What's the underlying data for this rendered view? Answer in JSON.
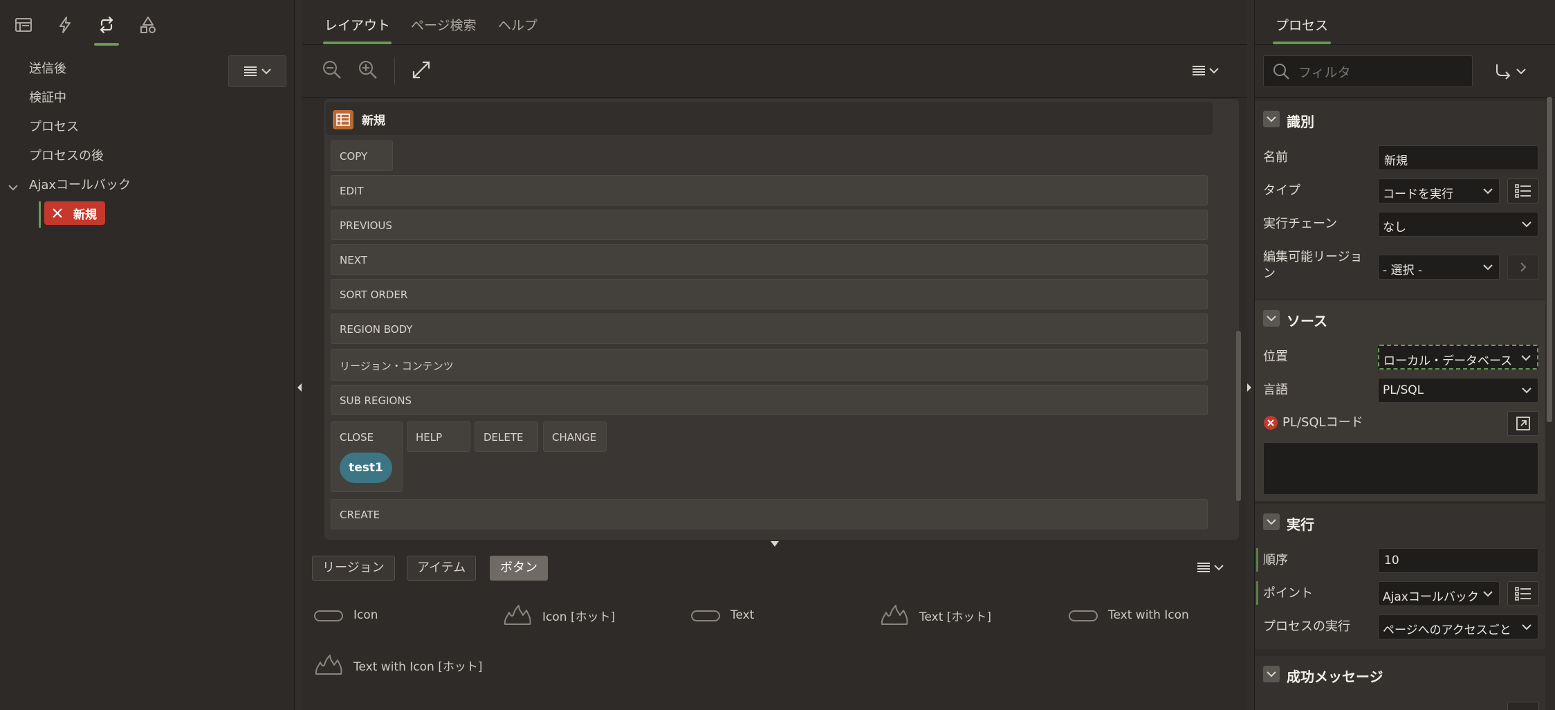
{
  "left_pane": {
    "tabs": [
      {
        "icon": "rendering-tree-icon"
      },
      {
        "icon": "dynamic-actions-icon"
      },
      {
        "icon": "processing-icon",
        "active": true
      },
      {
        "icon": "shared-components-icon"
      }
    ],
    "tree": {
      "items": [
        "送信後",
        "検証中",
        "プロセス",
        "プロセスの後",
        "Ajaxコールバック"
      ],
      "selected_node": "新規"
    }
  },
  "middle": {
    "tabs": [
      "レイアウト",
      "ページ検索",
      "ヘルプ"
    ],
    "active_tab": "レイアウト",
    "region": {
      "title": "新規",
      "slots": [
        "COPY",
        "EDIT",
        "PREVIOUS",
        "NEXT",
        "SORT ORDER",
        "REGION BODY",
        "リージョン・コンテンツ",
        "SUB REGIONS",
        "CLOSE",
        "HELP",
        "DELETE",
        "CHANGE",
        "CREATE"
      ],
      "button_label": "test1"
    },
    "gallery": {
      "tabs": [
        "リージョン",
        "アイテム",
        "ボタン"
      ],
      "active_tab": "ボタン",
      "items": [
        "Icon",
        "Icon [ホット]",
        "Text",
        "Text [ホット]",
        "Text with Icon",
        "Text with Icon [ホット]"
      ]
    }
  },
  "right": {
    "tab": "プロセス",
    "filter_placeholder": "フィルタ",
    "sections": {
      "identification": {
        "title": "識別",
        "name_label": "名前",
        "name_value": "新規",
        "type_label": "タイプ",
        "type_value": "コードを実行",
        "chain_label": "実行チェーン",
        "chain_value": "なし",
        "editable_region_label": "編集可能リージョン",
        "editable_region_value": "- 選択 -"
      },
      "source": {
        "title": "ソース",
        "location_label": "位置",
        "location_value": "ローカル・データベース",
        "language_label": "言語",
        "language_value": "PL/SQL",
        "code_label": "PL/SQLコード",
        "code_value": ""
      },
      "execution": {
        "title": "実行",
        "sequence_label": "順序",
        "sequence_value": "10",
        "point_label": "ポイント",
        "point_value": "Ajaxコールバック",
        "run_process_label": "プロセスの実行",
        "run_process_value": "ページへのアクセスごと"
      },
      "success_message": {
        "title": "成功メッセージ"
      }
    }
  },
  "colors": {
    "accent_green": "#6a9a55",
    "error_red": "#c7382c",
    "hot_button_teal": "#3c7584",
    "region_icon_orange": "#b86a3a"
  }
}
